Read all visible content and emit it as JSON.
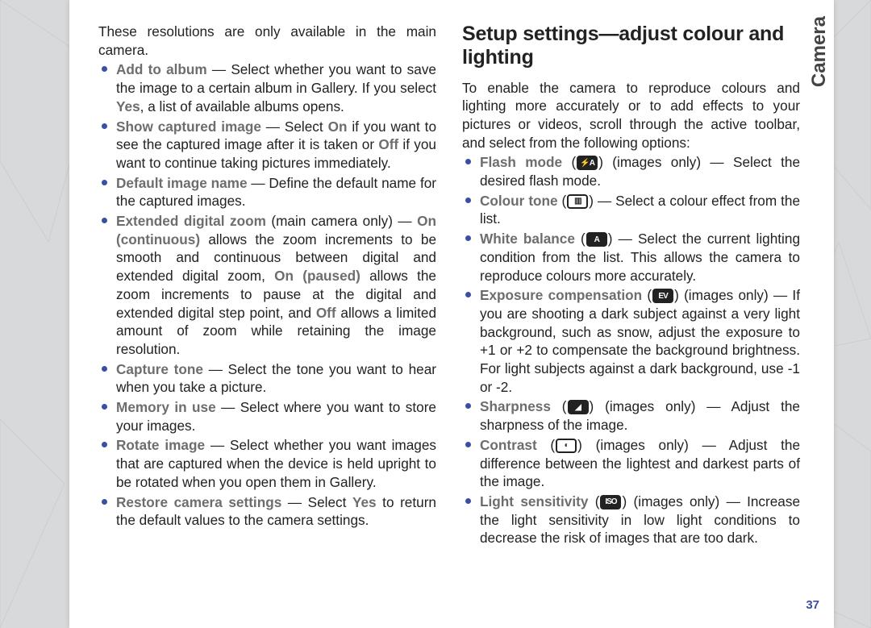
{
  "sideLabel": "Camera",
  "pageNumber": "37",
  "leftIntro": "These resolutions are only available in the main camera.",
  "left": [
    {
      "kw": "Add to album",
      "rest": " — Select whether you want to save the image to a certain album in Gallery. If you select ",
      "kw2": "Yes",
      "rest2": ", a list of available albums opens."
    },
    {
      "kw": "Show captured image",
      "rest": " — Select ",
      "kw2": "On",
      "rest2": " if you want to see the captured image after it is taken or ",
      "kw3": "Off",
      "rest3": " if you want to continue taking pictures immediately."
    },
    {
      "kw": "Default image name",
      "rest": " — Define the default name for the captured images."
    },
    {
      "kw": "Extended digital zoom",
      "rest": " (main camera only) — ",
      "kw2": "On (continuous)",
      "rest2": " allows the zoom increments to be smooth and continuous between digital and extended digital zoom, ",
      "kw3": "On (paused)",
      "rest3": " allows the zoom increments to pause at the digital and extended digital step point, and ",
      "kw4": "Off",
      "rest4": " allows a limited amount of zoom while retaining the image resolution."
    },
    {
      "kw": "Capture tone",
      "rest": " — Select the tone you want to hear when you take a picture."
    },
    {
      "kw": "Memory in use",
      "rest": " — Select where you want to store your images."
    },
    {
      "kw": "Rotate image",
      "rest": " — Select whether you want images that are captured when the device is held upright to be rotated when you open them in Gallery."
    },
    {
      "kw": "Restore camera settings",
      "rest": " — Select ",
      "kw2": "Yes",
      "rest2": " to return the default values to the camera settings."
    }
  ],
  "heading": "Setup settings—adjust colour and lighting",
  "rightIntro": "To enable the camera to reproduce colours and lighting more accurately or to add effects to your pictures or videos, scroll through the active toolbar, and select from the following options:",
  "right": [
    {
      "kw": "Flash mode",
      "icon": "flash",
      "rest": " (images only) — Select the desired flash mode."
    },
    {
      "kw": "Colour tone",
      "icon": "tone",
      "rest": " — Select a colour effect from the list."
    },
    {
      "kw": "White balance",
      "icon": "wb",
      "rest": " — Select the current lighting condition from the list. This allows the camera to reproduce colours more accurately."
    },
    {
      "kw": "Exposure compensation",
      "icon": "ev",
      "rest": " (images only) — If you are shooting a dark subject against a very light background, such as snow, adjust the exposure to +1 or +2 to compensate the background brightness. For light subjects against a dark background, use -1 or -2."
    },
    {
      "kw": "Sharpness",
      "icon": "sharp",
      "rest": " (images only) — Adjust the sharpness of the image."
    },
    {
      "kw": "Contrast",
      "icon": "contrast",
      "rest": " (images only) — Adjust the difference between the lightest and darkest parts of the image."
    },
    {
      "kw": "Light sensitivity",
      "icon": "iso",
      "rest": " (images only) — Increase the light sensitivity in low light conditions to decrease the risk of images that are too dark."
    }
  ],
  "icons": {
    "flash": {
      "dark": true,
      "glyph": "⚡A"
    },
    "tone": {
      "dark": false,
      "glyph": "▥"
    },
    "wb": {
      "dark": true,
      "glyph": "A"
    },
    "ev": {
      "dark": true,
      "glyph": "EV"
    },
    "sharp": {
      "dark": true,
      "glyph": "◢"
    },
    "contrast": {
      "dark": false,
      "glyph": "◐"
    },
    "iso": {
      "dark": true,
      "glyph": "ISO"
    }
  }
}
